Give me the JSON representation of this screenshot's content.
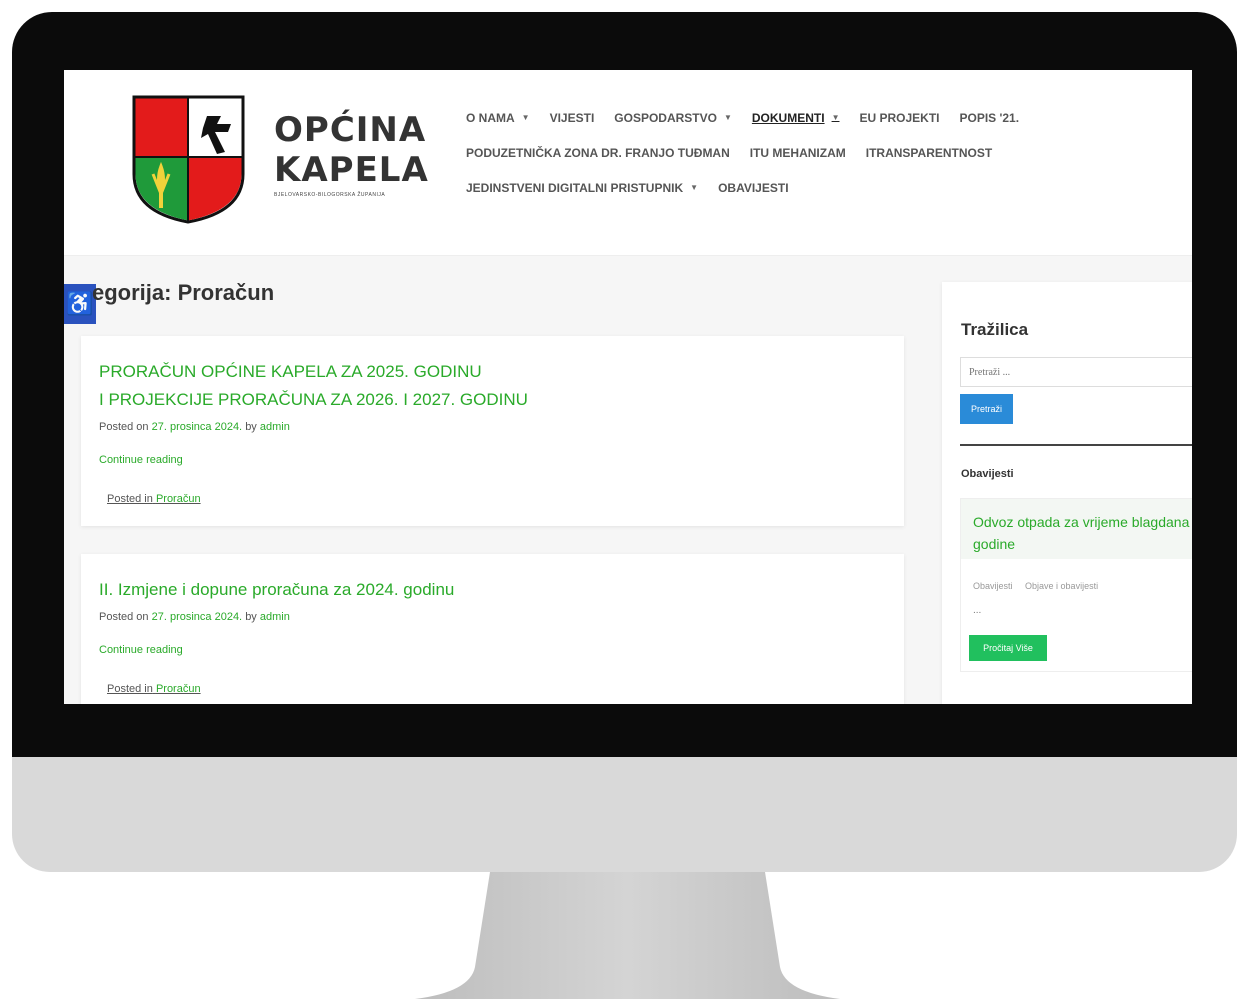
{
  "site": {
    "logo_line1": "OPĆINA",
    "logo_line2": "KAPELA",
    "logo_sub": "BJELOVARSKO-BILOGORSKA ŽUPANIJA"
  },
  "nav": {
    "row1": [
      {
        "label": "O NAMA",
        "caret": "▼"
      },
      {
        "label": "VIJESTI"
      },
      {
        "label": "GOSPODARSTVO",
        "caret": "▼"
      },
      {
        "label": "DOKUMENTI",
        "caret": "▼"
      },
      {
        "label": "EU PROJEKTI"
      },
      {
        "label": "POPIS '21."
      }
    ],
    "row2": [
      {
        "label": "PODUZETNIČKA ZONA DR. FRANJO TUĐMAN"
      },
      {
        "label": "ITU MEHANIZAM"
      },
      {
        "label": "ITRANSPARENTNOST"
      }
    ],
    "row3": [
      {
        "label": "JEDINSTVENI DIGITALNI PRISTUPNIK",
        "caret": "▼"
      },
      {
        "label": "OBAVIJESTI"
      }
    ]
  },
  "page": {
    "title": "egorija: Proračun",
    "accessibility_icon": "♿"
  },
  "posts": [
    {
      "title_line1": "PRORAČUN OPĆINE KAPELA ZA 2025. GODINU",
      "title_line2": "I PROJEKCIJE PRORAČUNA ZA 2026. I 2027. GODINU",
      "posted_on": "Posted on",
      "date": "27. prosinca 2024.",
      "by": "by",
      "author": "admin",
      "continue": "Continue reading",
      "posted_in": "Posted in",
      "category": "Proračun"
    },
    {
      "title_line1": "II. Izmjene i dopune proračuna za 2024. godinu",
      "posted_on": "Posted on",
      "date": "27. prosinca 2024.",
      "by": "by",
      "author": "admin",
      "continue": "Continue reading",
      "posted_in": "Posted in",
      "category": "Proračun"
    }
  ],
  "sidebar": {
    "search_title": "Tražilica",
    "search_placeholder": "Pretraži ...",
    "search_button": "Pretraži",
    "section_title": "Obavijesti",
    "notice": {
      "title": "Odvoz otpada za vrijeme blagdana godine",
      "tags": [
        "Obavijesti",
        "Objave i obavijesti"
      ],
      "ellipsis": "...",
      "button": "Pročitaj Više"
    }
  },
  "colors": {
    "accent_green": "#2aaa2a",
    "button_blue": "#2a8bd8",
    "button_green": "#21c05e",
    "access_blue": "#2a52be"
  }
}
